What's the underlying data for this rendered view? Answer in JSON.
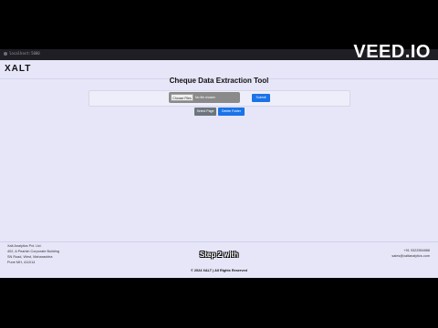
{
  "browser": {
    "url": "localhost:5000"
  },
  "header": {
    "logo": "XALT"
  },
  "main": {
    "title": "Cheque Data Extraction Tool",
    "upload": {
      "choose_label": "Choose Files",
      "no_file_text": "No file chosen",
      "submit_label": "Submit"
    },
    "actions": {
      "select_label": "Select Page",
      "delete_label": "Delete Folder"
    }
  },
  "footer": {
    "address": [
      "Xalt Analytics Pvt. Ltd.",
      "402, A Pearlsh Corporate Building",
      "SN Road, West, Maharashtra",
      "Pune MH, 411014"
    ],
    "phone": "+91 9322554888",
    "email": "sales@xaltanalytics.com",
    "copyright": "© 2024 XALT | All Rights Reserved"
  },
  "overlay": {
    "caption": "Step 2 with",
    "watermark": "VEED.IO"
  },
  "colors": {
    "primary": "#1a73e8",
    "secondary": "#6c757d",
    "page_bg": "#e6e6f8"
  }
}
